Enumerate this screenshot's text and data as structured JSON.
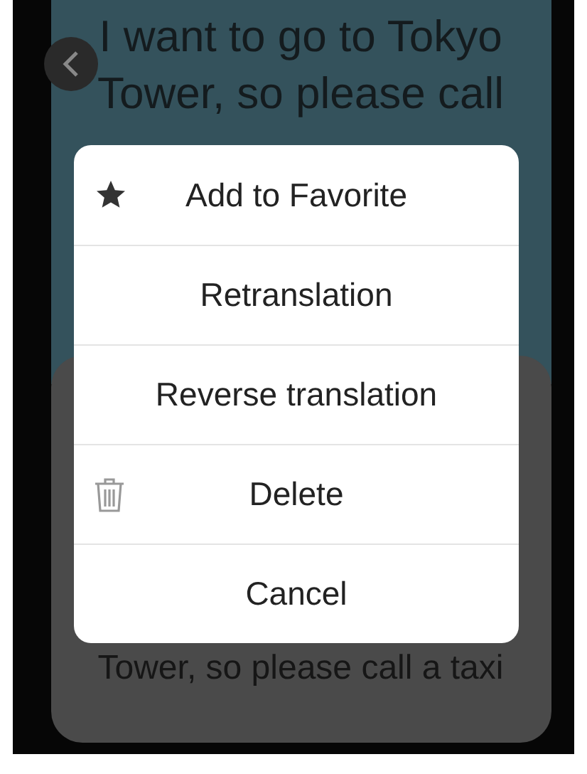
{
  "top_card": {
    "lines": [
      "I want to go to Tokyo",
      "Tower, so please call"
    ]
  },
  "bottom_card": {
    "lines": [
      "Tower, so please call a taxi"
    ]
  },
  "menu": {
    "items": [
      {
        "label": "Add to Favorite",
        "kind": "favorite"
      },
      {
        "label": "Retranslation",
        "kind": "plain"
      },
      {
        "label": "Reverse translation",
        "kind": "plain"
      },
      {
        "label": "Delete",
        "kind": "delete"
      },
      {
        "label": "Cancel",
        "kind": "plain"
      }
    ]
  }
}
